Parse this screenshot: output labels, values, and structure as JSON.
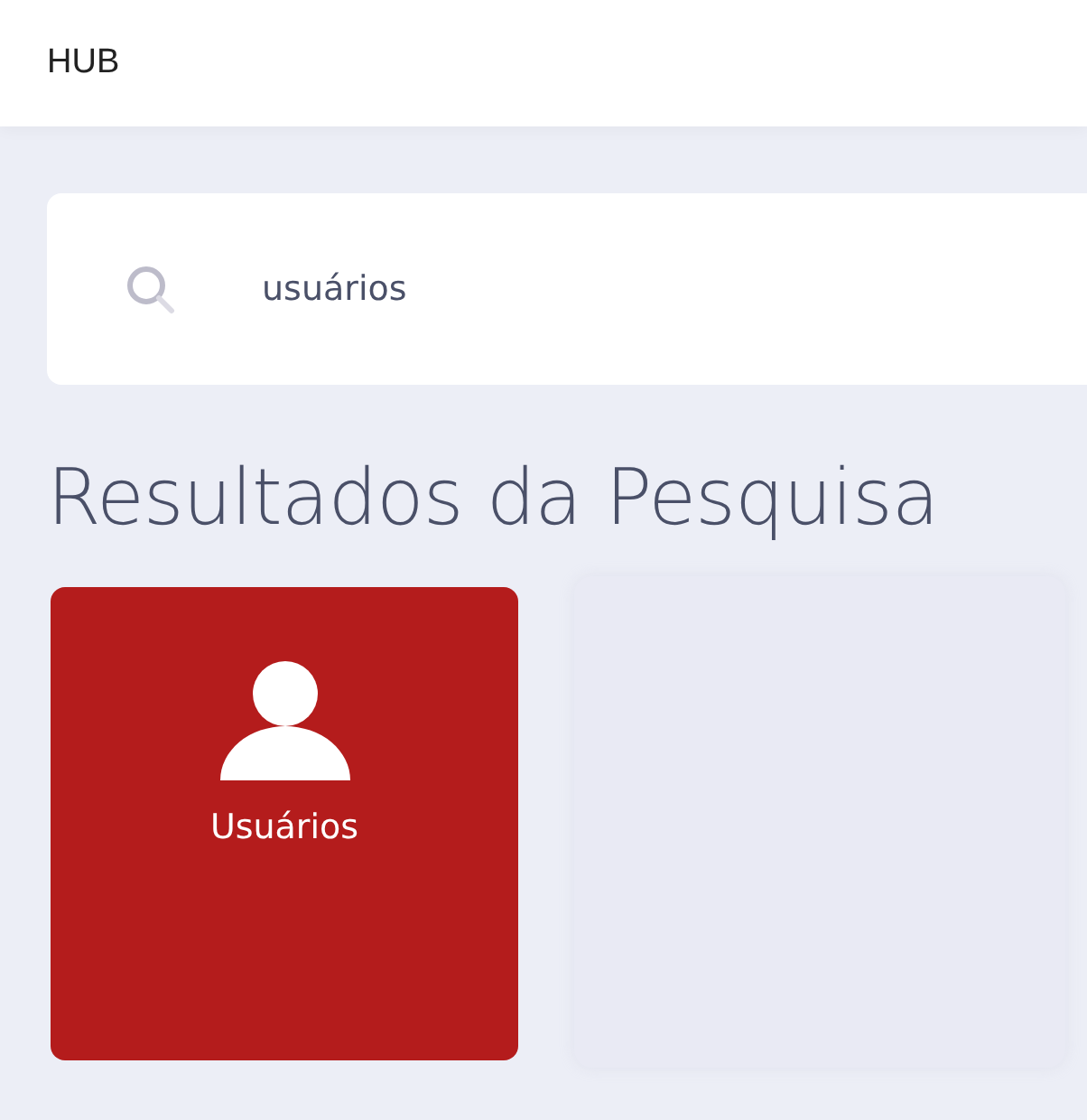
{
  "header": {
    "title": "HUB"
  },
  "search": {
    "value": "usuários"
  },
  "results_heading": "Resultados da Pesquisa",
  "results": [
    {
      "label": "Usuários",
      "kind": "user",
      "color": "#b41c1c"
    }
  ]
}
